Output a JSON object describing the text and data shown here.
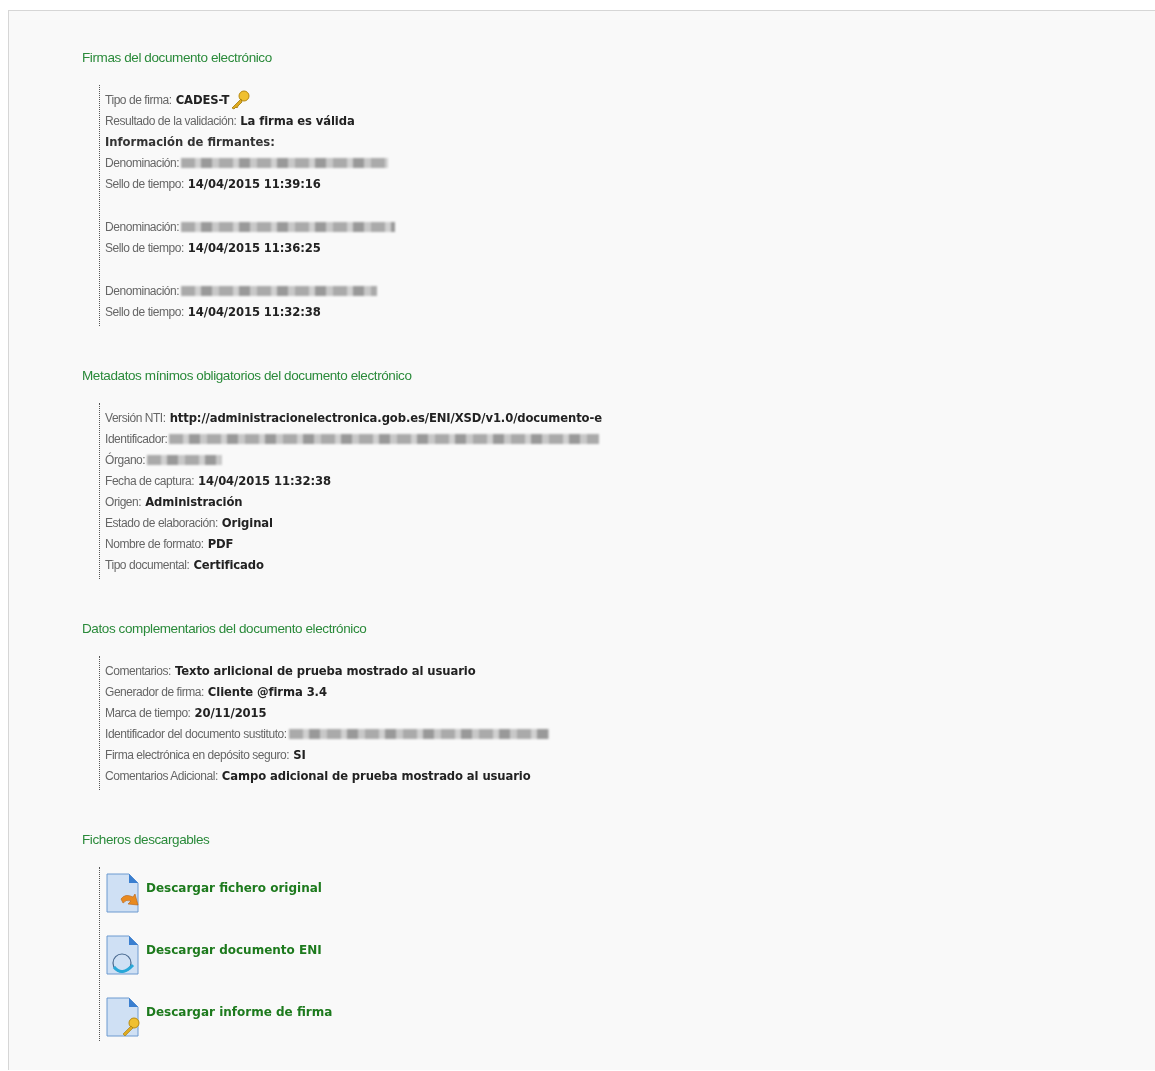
{
  "signatures": {
    "title": "Firmas del documento electrónico",
    "type_label": "Tipo de firma:",
    "type": "CADES-T",
    "result_label": "Resultado de la validación:",
    "result": "La firma es válida",
    "signers_heading": "Información de firmantes:",
    "signers": [
      {
        "name_label": "Denominación:",
        "name_redacted": true,
        "time_label": "Sello de tiempo:",
        "time": "14/04/2015 11:39:16"
      },
      {
        "name_label": "Denominación:",
        "name_redacted": true,
        "time_label": "Sello de tiempo:",
        "time": "14/04/2015 11:36:25"
      },
      {
        "name_label": "Denominación:",
        "name_redacted": true,
        "time_label": "Sello de tiempo:",
        "time": "14/04/2015 11:32:38"
      }
    ]
  },
  "metadata": {
    "title": "Metadatos mínimos obligatorios del documento electrónico",
    "rows": [
      {
        "label": "Versión NTI:",
        "value": "http://administracionelectronica.gob.es/ENI/XSD/v1.0/documento-e"
      },
      {
        "label": "Identificador:",
        "redacted": true
      },
      {
        "label": "Órgano:",
        "redacted": true
      },
      {
        "label": "Fecha de captura:",
        "value": "14/04/2015 11:32:38"
      },
      {
        "label": "Origen:",
        "value": "Administración"
      },
      {
        "label": "Estado de elaboración:",
        "value": "Original"
      },
      {
        "label": "Nombre de formato:",
        "value": "PDF"
      },
      {
        "label": "Tipo documental:",
        "value": "Certificado"
      }
    ]
  },
  "complementary": {
    "title": "Datos complementarios del documento electrónico",
    "rows": [
      {
        "label": "Comentarios:",
        "value": "Texto arlicional de prueba mostrado al usuario"
      },
      {
        "label": "Generador de firma:",
        "value": "Cliente @firma 3.4"
      },
      {
        "label": "Marca de tiempo:",
        "value": "20/11/2015"
      },
      {
        "label": "Identificador del documento sustituto:",
        "redacted": true
      },
      {
        "label": "Firma electrónica en depósito seguro:",
        "value": "SI"
      },
      {
        "label": "Comentarios Adicional:",
        "value": "Campo adicional de prueba mostrado al usuario"
      }
    ]
  },
  "downloads": {
    "title": "Ficheros descargables",
    "files": [
      {
        "kind": "original",
        "label": "Descargar fichero original"
      },
      {
        "kind": "eni",
        "label": "Descargar documento ENI"
      },
      {
        "kind": "report",
        "label": "Descargar informe de firma"
      }
    ]
  }
}
